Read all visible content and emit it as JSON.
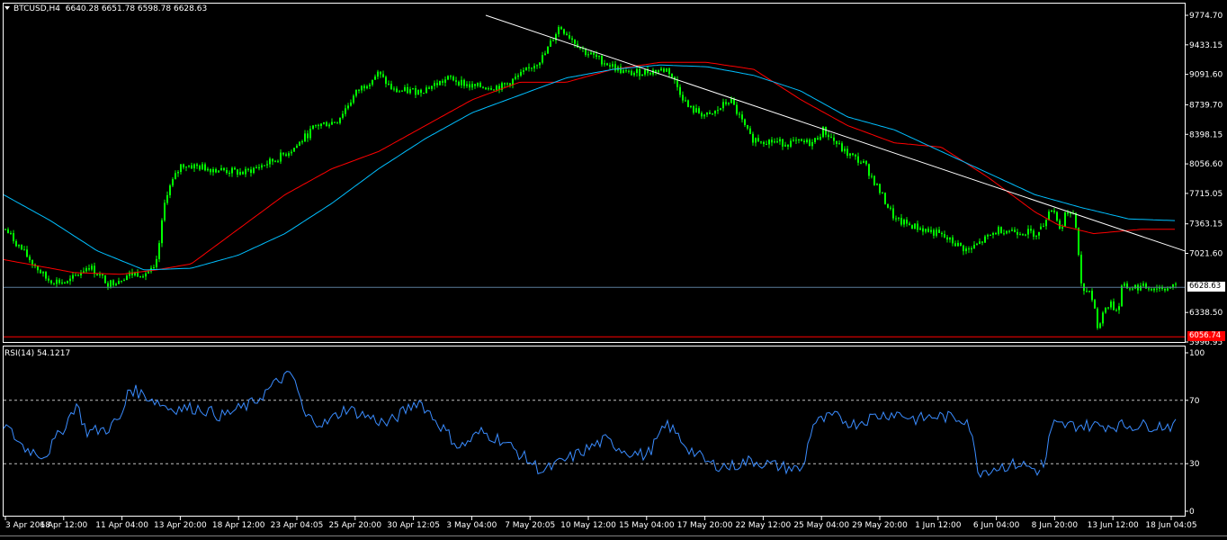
{
  "colors": {
    "background": "#000000",
    "frame": "#ffffff",
    "candle": "#00ff00",
    "ma_fast": "#ff0000",
    "ma_slow": "#00bfff",
    "trendline": "#ffffff",
    "price_line": "#5b7a9a",
    "level_line": "#ff0000",
    "rsi_line": "#3a8cff",
    "rsi_levels": "#c0c0c0"
  },
  "main_pane": {
    "symbol_label": "BTCUSD,H4",
    "ohlc_label": "6640.28 6651.78 6598.78 6628.63",
    "y_ticks": [
      "9774.70",
      "9433.15",
      "9091.60",
      "8739.70",
      "8398.15",
      "8056.60",
      "7715.05",
      "7363.15",
      "7021.60",
      "6338.50",
      "5996.95"
    ],
    "current_price_label": "6628.63",
    "level_label": "6056.74"
  },
  "rsi_pane": {
    "label": "RSI(14) 54.1217",
    "y_ticks": [
      "100",
      "70",
      "30",
      "0"
    ]
  },
  "x_ticks": [
    "3 Apr 2018",
    "6 Apr 12:00",
    "11 Apr 04:00",
    "13 Apr 20:00",
    "18 Apr 12:00",
    "23 Apr 04:05",
    "25 Apr 20:00",
    "30 Apr 12:05",
    "3 May 04:00",
    "7 May 20:05",
    "10 May 12:00",
    "15 May 04:00",
    "17 May 20:00",
    "22 May 12:00",
    "25 May 04:00",
    "29 May 20:00",
    "1 Jun 12:00",
    "6 Jun 04:00",
    "8 Jun 20:00",
    "13 Jun 12:00",
    "18 Jun 04:05"
  ],
  "chart_data": {
    "type": "candlestick",
    "symbol": "BTCUSD",
    "timeframe": "H4",
    "ylim": [
      5996.95,
      9774.7
    ],
    "close_profile": [
      [
        0,
        7300
      ],
      [
        0.02,
        7000
      ],
      [
        0.04,
        6720
      ],
      [
        0.06,
        6680
      ],
      [
        0.08,
        6880
      ],
      [
        0.1,
        6670
      ],
      [
        0.12,
        6780
      ],
      [
        0.135,
        6800
      ],
      [
        0.145,
        6830
      ],
      [
        0.155,
        7700
      ],
      [
        0.17,
        8050
      ],
      [
        0.2,
        8000
      ],
      [
        0.23,
        7950
      ],
      [
        0.26,
        8100
      ],
      [
        0.28,
        8250
      ],
      [
        0.3,
        8500
      ],
      [
        0.32,
        8550
      ],
      [
        0.34,
        8900
      ],
      [
        0.36,
        9100
      ],
      [
        0.375,
        8900
      ],
      [
        0.4,
        8900
      ],
      [
        0.43,
        9050
      ],
      [
        0.45,
        8950
      ],
      [
        0.48,
        8950
      ],
      [
        0.5,
        9100
      ],
      [
        0.52,
        9300
      ],
      [
        0.535,
        9650
      ],
      [
        0.56,
        9350
      ],
      [
        0.6,
        9100
      ],
      [
        0.64,
        9150
      ],
      [
        0.66,
        8700
      ],
      [
        0.68,
        8600
      ],
      [
        0.7,
        8800
      ],
      [
        0.72,
        8350
      ],
      [
        0.75,
        8300
      ],
      [
        0.78,
        8300
      ],
      [
        0.79,
        8450
      ],
      [
        0.81,
        8200
      ],
      [
        0.83,
        8050
      ],
      [
        0.86,
        7400
      ],
      [
        0.9,
        7250
      ],
      [
        0.93,
        7050
      ],
      [
        0.96,
        7300
      ],
      [
        1,
        7250
      ]
    ],
    "close_profile_2": [
      [
        0,
        7300
      ],
      [
        0.03,
        7400
      ],
      [
        0.06,
        7550
      ],
      [
        0.09,
        7500
      ],
      [
        0.12,
        7380
      ],
      [
        0.15,
        7300
      ],
      [
        0.18,
        7500
      ],
      [
        0.2,
        7450
      ],
      [
        0.24,
        7500
      ],
      [
        0.27,
        7250
      ],
      [
        0.3,
        6650
      ],
      [
        0.34,
        6600
      ],
      [
        0.38,
        6500
      ],
      [
        0.42,
        6200
      ],
      [
        0.45,
        6250
      ],
      [
        0.48,
        6400
      ],
      [
        0.52,
        6450
      ],
      [
        0.55,
        6360
      ],
      [
        0.58,
        6420
      ],
      [
        0.6,
        6620
      ],
      [
        0.62,
        6628.63
      ]
    ],
    "ma_fast_profile": [
      [
        0,
        6950
      ],
      [
        0.06,
        6800
      ],
      [
        0.1,
        6780
      ],
      [
        0.13,
        6830
      ],
      [
        0.16,
        6900
      ],
      [
        0.2,
        7300
      ],
      [
        0.24,
        7700
      ],
      [
        0.28,
        8000
      ],
      [
        0.32,
        8200
      ],
      [
        0.36,
        8500
      ],
      [
        0.4,
        8800
      ],
      [
        0.44,
        9000
      ],
      [
        0.48,
        9000
      ],
      [
        0.52,
        9150
      ],
      [
        0.56,
        9230
      ],
      [
        0.6,
        9230
      ],
      [
        0.64,
        9150
      ],
      [
        0.68,
        8800
      ],
      [
        0.72,
        8500
      ],
      [
        0.76,
        8300
      ],
      [
        0.8,
        8250
      ],
      [
        0.84,
        7900
      ],
      [
        0.88,
        7500
      ],
      [
        0.9,
        7350
      ],
      [
        0.93,
        7250
      ],
      [
        0.97,
        7300
      ],
      [
        1,
        7300
      ]
    ],
    "ma_slow_profile": [
      [
        0,
        7700
      ],
      [
        0.04,
        7400
      ],
      [
        0.08,
        7050
      ],
      [
        0.12,
        6830
      ],
      [
        0.16,
        6850
      ],
      [
        0.2,
        7000
      ],
      [
        0.24,
        7250
      ],
      [
        0.28,
        7600
      ],
      [
        0.32,
        8000
      ],
      [
        0.36,
        8350
      ],
      [
        0.4,
        8650
      ],
      [
        0.44,
        8850
      ],
      [
        0.48,
        9050
      ],
      [
        0.52,
        9150
      ],
      [
        0.56,
        9200
      ],
      [
        0.6,
        9180
      ],
      [
        0.64,
        9080
      ],
      [
        0.68,
        8900
      ],
      [
        0.72,
        8600
      ],
      [
        0.76,
        8450
      ],
      [
        0.8,
        8200
      ],
      [
        0.84,
        7950
      ],
      [
        0.88,
        7700
      ],
      [
        0.92,
        7550
      ],
      [
        0.96,
        7420
      ],
      [
        1,
        7400
      ]
    ],
    "trendline": {
      "from": {
        "date": "3 May 04:00",
        "price": 9774.7
      },
      "to": {
        "date": "18 Jun 04:05",
        "price": 7050
      }
    },
    "current_price": 6628.63,
    "level": 6056.74,
    "rsi": {
      "period": 14,
      "last": 54.1217,
      "levels": [
        70,
        30
      ],
      "ylim": [
        0,
        100
      ],
      "profile": [
        [
          0,
          55
        ],
        [
          0.02,
          40
        ],
        [
          0.04,
          35
        ],
        [
          0.06,
          55
        ],
        [
          0.07,
          68
        ],
        [
          0.08,
          50
        ],
        [
          0.1,
          52
        ],
        [
          0.115,
          60
        ],
        [
          0.12,
          78
        ],
        [
          0.14,
          72
        ],
        [
          0.16,
          65
        ],
        [
          0.19,
          65
        ],
        [
          0.21,
          60
        ],
        [
          0.24,
          68
        ],
        [
          0.27,
          85
        ],
        [
          0.28,
          85
        ],
        [
          0.29,
          60
        ],
        [
          0.31,
          55
        ],
        [
          0.33,
          65
        ],
        [
          0.35,
          60
        ],
        [
          0.37,
          55
        ],
        [
          0.39,
          65
        ],
        [
          0.4,
          70
        ],
        [
          0.42,
          55
        ],
        [
          0.44,
          40
        ],
        [
          0.46,
          50
        ],
        [
          0.48,
          45
        ],
        [
          0.5,
          35
        ],
        [
          0.52,
          25
        ],
        [
          0.55,
          35
        ],
        [
          0.58,
          45
        ],
        [
          0.6,
          38
        ],
        [
          0.62,
          35
        ],
        [
          0.64,
          55
        ],
        [
          0.66,
          40
        ],
        [
          0.68,
          30
        ],
        [
          0.7,
          28
        ],
        [
          0.72,
          32
        ],
        [
          0.75,
          28
        ],
        [
          0.77,
          26
        ],
        [
          0.78,
          55
        ],
        [
          0.8,
          60
        ],
        [
          0.82,
          55
        ],
        [
          0.84,
          60
        ],
        [
          0.86,
          62
        ],
        [
          0.88,
          58
        ],
        [
          0.9,
          60
        ],
        [
          0.93,
          58
        ],
        [
          0.94,
          25
        ],
        [
          0.96,
          28
        ],
        [
          0.98,
          30
        ],
        [
          1,
          25
        ]
      ],
      "profile_2": [
        [
          0,
          30
        ],
        [
          0.03,
          28
        ],
        [
          0.06,
          45
        ],
        [
          0.08,
          50
        ],
        [
          0.1,
          55
        ],
        [
          0.12,
          54.1217
        ]
      ]
    }
  }
}
